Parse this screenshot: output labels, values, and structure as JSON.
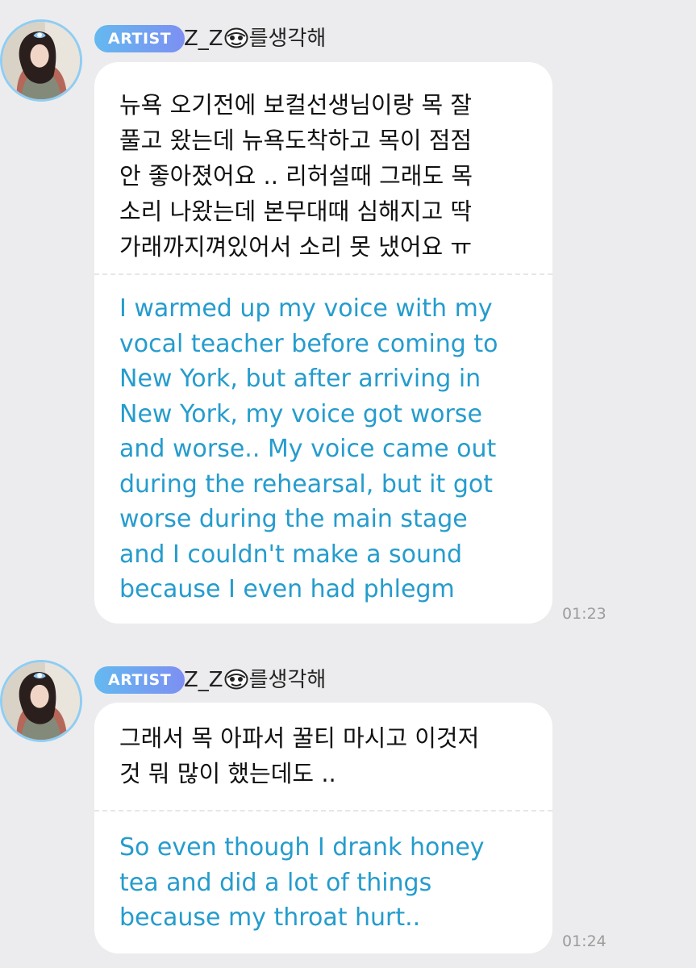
{
  "colors": {
    "background": "#ececee",
    "bubble": "#ffffff",
    "translation_text": "#259ccd",
    "badge_gradient_start": "#64b9f0",
    "badge_gradient_end": "#7d8ff2",
    "avatar_ring": "#8fcdf3",
    "timestamp": "#9c9c9c"
  },
  "messages": [
    {
      "badge": "ARTIST",
      "name_prefix": "Z_Z",
      "name_icon": "sticker-face-icon",
      "name_suffix": "를생각해",
      "original_text": "뉴욕 오기전에 보컬선생님이랑 목 잘\n풀고 왔는데 뉴욕도착하고 목이 점점\n안 좋아졌어요 .. 리허설때 그래도 목\n소리 나왔는데 본무대때 심해지고 딱\n가래까지껴있어서 소리 못 냈어요 ㅠ",
      "translation_text": "I warmed up my voice with my\nvocal teacher before coming to\nNew York, but after arriving in\nNew York, my voice got worse\nand worse.. My voice came out\nduring the rehearsal, but it got\nworse during the main stage\nand I couldn't make a sound\nbecause I even had phlegm",
      "time": "01:23"
    },
    {
      "badge": "ARTIST",
      "name_prefix": "Z_Z",
      "name_icon": "sticker-face-icon",
      "name_suffix": "를생각해",
      "original_text": "그래서 목 아파서 꿀티 마시고 이것저\n것 뭐 많이 했는데도 ..",
      "translation_text": "So even though I drank honey\ntea and did a lot of things\nbecause my throat hurt..",
      "time": "01:24"
    }
  ]
}
